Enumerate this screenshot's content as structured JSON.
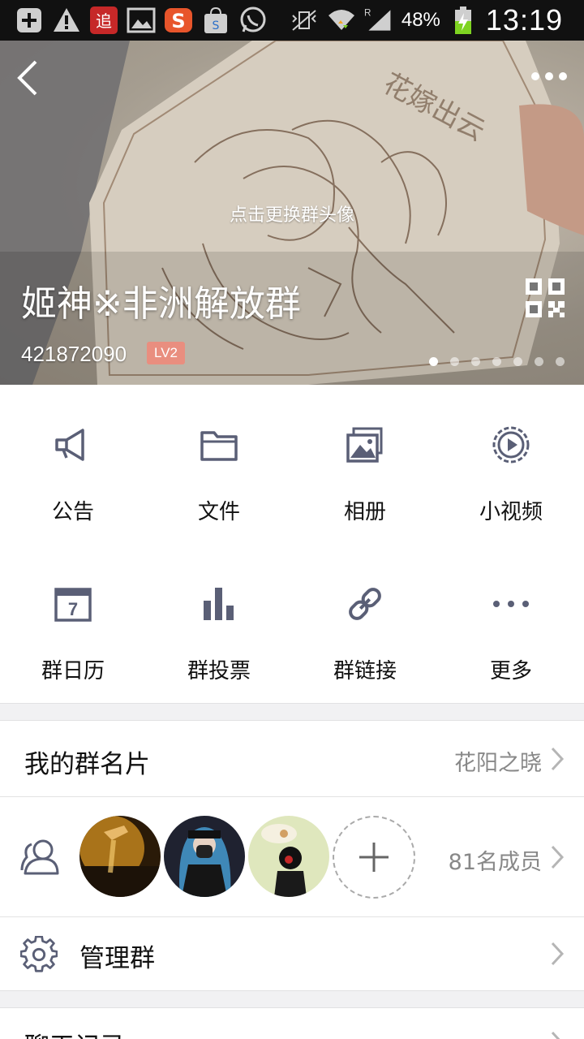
{
  "status_bar": {
    "notification_icons": [
      "add-box-icon",
      "warning-icon",
      "chase-app-icon",
      "image-icon",
      "s-app-icon",
      "store-bag-icon",
      "whatsapp-icon"
    ],
    "system_icons": [
      "vibrate-icon",
      "wifi-icon",
      "roaming-icon",
      "signal-icon",
      "battery-charging-icon"
    ],
    "roaming_label": "R",
    "battery": "48%",
    "time": "13:19"
  },
  "hero": {
    "change_avatar_hint": "点击更换群头像",
    "group_name": "姬神※非洲解放群",
    "group_id": "421872090",
    "level_badge": "LV2",
    "page_dots": 7,
    "active_dot": 0,
    "photo_engraving_text": "花嫁出云"
  },
  "features": [
    {
      "label": "公告",
      "icon": "megaphone-icon"
    },
    {
      "label": "文件",
      "icon": "folder-icon"
    },
    {
      "label": "相册",
      "icon": "album-icon"
    },
    {
      "label": "小视频",
      "icon": "video-icon"
    },
    {
      "label": "群日历",
      "icon": "calendar-icon"
    },
    {
      "label": "群投票",
      "icon": "vote-chart-icon"
    },
    {
      "label": "群链接",
      "icon": "link-icon"
    },
    {
      "label": "更多",
      "icon": "more-dots-icon"
    }
  ],
  "group_card": {
    "title": "我的群名片",
    "value": "花阳之晓"
  },
  "members": {
    "count_label": "81名成员",
    "avatars": [
      "member-avatar-sunset",
      "member-avatar-gasmask",
      "member-avatar-girl"
    ]
  },
  "manage": {
    "title": "管理群"
  },
  "chat_history": {
    "title": "聊天记录"
  },
  "colors": {
    "icon_color": "#5a5f76",
    "badge_color": "#e98e7f",
    "section_gap": "#f1f1f3"
  }
}
